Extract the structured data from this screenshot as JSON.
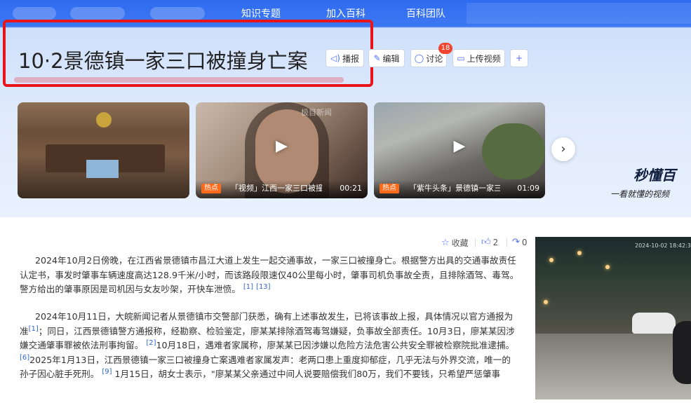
{
  "topnav": {
    "items": [
      "知识专题",
      "加入百科",
      "百科团队"
    ]
  },
  "title": "10·2景德镇一家三口被撞身亡案",
  "toolbar": {
    "report": "播报",
    "edit": "编辑",
    "discuss": "讨论",
    "discuss_badge": "18",
    "upload_video": "上传视频",
    "add": "+"
  },
  "media": [
    {
      "tag": "",
      "caption": "",
      "duration": ""
    },
    {
      "watermark": "极目新闻",
      "tag": "热点",
      "caption": "「视频」江西一家三口被撞...",
      "duration": "00:21"
    },
    {
      "tag": "热点",
      "caption": "「紫牛头条」景德镇一家三...",
      "duration": "01:09"
    }
  ],
  "brand": {
    "name": "秒懂百",
    "slogan": "一看就懂的视频"
  },
  "actions": {
    "collect": "收藏",
    "like_count": "2",
    "share_count": "0"
  },
  "paragraphs": {
    "p1": "2024年10月2日傍晚，在江西省景德镇市昌江大道上发生一起交通事故，一家三口被撞身亡。根据警方出具的交通事故责任认定书，事发时肇事车辆速度高达128.9千米/小时，而该路段限速仅40公里每小时，肇事司机负事故全责，且排除酒驾、毒驾。警方给出的肇事原因是司机因与女友吵架，开快车泄愤。",
    "p1_ref1": "[1]",
    "p1_ref2": "[13]",
    "p2a": "2024年10月11日，大皖新闻记者从景德镇市交警部门获悉，确有上述事故发生，已将该事故上报，具体情况以官方通报为准",
    "p2_ref1": "[1]",
    "p2b": "；同日，江西景德镇警方通报称，经勘察、检验鉴定，廖某某排除酒驾毒驾嫌疑，负事故全部责任。10月3日，廖某某因涉嫌交通肇事罪被依法刑事拘留。",
    "p2_ref2": "[2]",
    "p2c": "10月18日，遇难者家属称，廖某某已因涉嫌以危险方法危害公共安全罪被检察院批准逮捕。",
    "p2_ref3": "[6]",
    "p2d": "2025年1月13日，江西景德镇一家三口被撞身亡案遇难者家属发声：老两口患上重度抑郁症，几乎无法与外界交流，唯一的孙子因心脏手死刑。",
    "p2_ref4": "[9]",
    "p2e": "1月15日，胡女士表示，\"廖某某父亲通过中间人说要赔偿我们80万，我们不要钱，只希望严惩肇事"
  },
  "side_photo": {
    "timestamp": "2024-10-02 18:42:32"
  }
}
